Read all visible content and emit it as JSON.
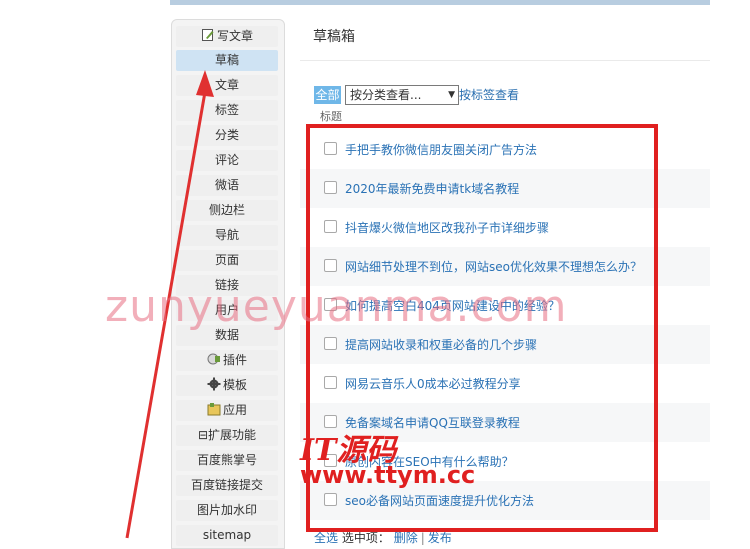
{
  "sidebar": {
    "items": [
      {
        "label": "写文章",
        "icon": "edit-icon"
      },
      {
        "label": "草稿",
        "active": true
      },
      {
        "label": "文章"
      },
      {
        "label": "标签"
      },
      {
        "label": "分类"
      },
      {
        "label": "评论"
      },
      {
        "label": "微语"
      },
      {
        "label": "侧边栏"
      },
      {
        "label": "导航"
      },
      {
        "label": "页面"
      },
      {
        "label": "链接"
      },
      {
        "label": "用户"
      },
      {
        "label": "数据"
      },
      {
        "label": "插件",
        "icon": "plugin-icon"
      },
      {
        "label": "模板",
        "icon": "gear-icon"
      },
      {
        "label": "应用",
        "icon": "app-icon"
      },
      {
        "label": "扩展功能",
        "prefix": "⊟"
      },
      {
        "label": "百度熊掌号"
      },
      {
        "label": "百度链接提交"
      },
      {
        "label": "图片加水印"
      },
      {
        "label": "sitemap"
      }
    ]
  },
  "main": {
    "title": "草稿箱",
    "filter": {
      "all_label": "全部",
      "category_select": "按分类查看...",
      "tag_link": "按标签查看"
    },
    "column_header": "标题",
    "drafts": [
      "手把手教你微信朋友圈关闭广告方法",
      "2020年最新免费申请tk域名教程",
      "抖音爆火微信地区改我孙子市详细步骤",
      "网站细节处理不到位，网站seo优化效果不理想怎么办？",
      "如何提高空白404页网站建设中的经验？",
      "提高网站收录和权重必备的几个步骤",
      "网易云音乐人0成本必过教程分享",
      "免备案域名申请QQ互联登录教程",
      "原创内容在SEO中有什么帮助？",
      "seo必备网站页面速度提升优化方法"
    ],
    "footer": {
      "select_all": "全选",
      "selected_label": "选中项：",
      "delete": "删除",
      "separator": "|",
      "publish": "发布"
    }
  },
  "overlay": {
    "watermark": "zunyueyuanma.com",
    "logo_cn": "IT源码",
    "logo_url": "www.ttym.cc",
    "highlight_color": "#e02020"
  }
}
